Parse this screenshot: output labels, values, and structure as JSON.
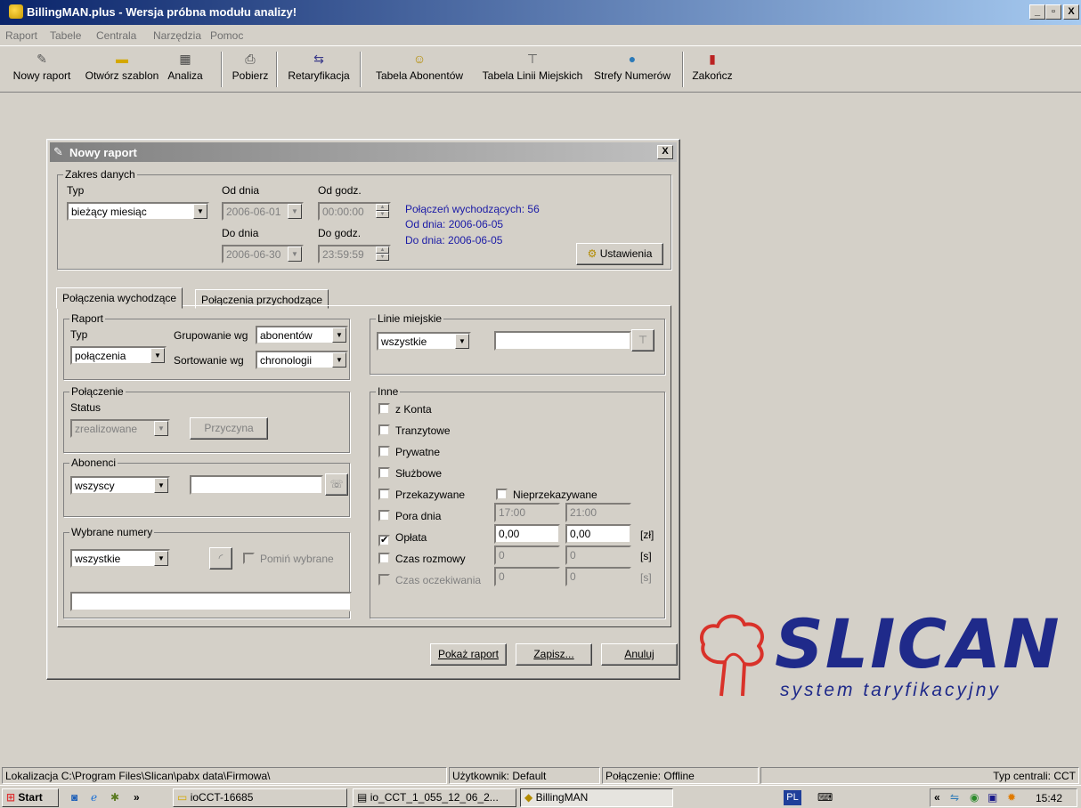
{
  "window": {
    "title": "BillingMAN.plus - Wersja próbna modułu analizy!",
    "controls": [
      "_",
      "▫",
      "X"
    ]
  },
  "menu": [
    "Raport",
    "Tabele",
    "Centrala",
    "Narzędzia",
    "Pomoc"
  ],
  "toolbar": {
    "new_report": "Nowy raport",
    "open_template": "Otwórz szablon",
    "analysis": "Analiza",
    "fetch": "Pobierz",
    "retarification": "Retaryfikacja",
    "subscribers_table": "Tabela Abonentów",
    "city_lines_table": "Tabela Linii Miejskich",
    "number_zones": "Strefy Numerów",
    "exit": "Zakończ"
  },
  "dialog": {
    "title": "Nowy raport",
    "close": "X",
    "data_range": {
      "legend": "Zakres danych",
      "type_label": "Typ",
      "type_value": "bieżący miesiąc",
      "from_day_label": "Od dnia",
      "from_day_value": "2006-06-01",
      "from_time_label": "Od godz.",
      "from_time_value": "00:00:00",
      "to_day_label": "Do dnia",
      "to_day_value": "2006-06-30",
      "to_time_label": "Do godz.",
      "to_time_value": "23:59:59",
      "info_calls": "Połączeń wychodzących: 56",
      "info_from": "Od dnia: 2006-06-05",
      "info_to": "Do dnia: 2006-06-05",
      "settings_button": "Ustawienia"
    },
    "tabs": [
      "Połączenia wychodzące",
      "Połączenia przychodzące"
    ],
    "report": {
      "legend": "Raport",
      "type_label": "Typ",
      "type_value": "połączenia",
      "group_label": "Grupowanie wg",
      "group_value": "abonentów",
      "sort_label": "Sortowanie wg",
      "sort_value": "chronologii"
    },
    "connection": {
      "legend": "Połączenie",
      "status_label": "Status",
      "status_value": "zrealizowane",
      "reason_button": "Przyczyna"
    },
    "subscribers": {
      "legend": "Abonenci",
      "value": "wszyscy"
    },
    "selected_numbers": {
      "legend": "Wybrane numery",
      "value": "wszystkie",
      "skip_selected": "Pomiń wybrane"
    },
    "city_lines": {
      "legend": "Linie miejskie",
      "value": "wszystkie"
    },
    "other": {
      "legend": "Inne",
      "from_account": "z Konta",
      "transit": "Tranzytowe",
      "private": "Prywatne",
      "business": "Służbowe",
      "forwarded": "Przekazywane",
      "not_forwarded": "Nieprzekazywane",
      "time_of_day": "Pora dnia",
      "time_from": "17:00",
      "time_to": "21:00",
      "fee": "Opłata",
      "fee_from": "0,00",
      "fee_to": "0,00",
      "fee_unit": "[zł]",
      "call_time": "Czas rozmowy",
      "call_from": "0",
      "call_to": "0",
      "call_unit": "[s]",
      "wait_time": "Czas oczekiwania",
      "wait_from": "0",
      "wait_to": "0",
      "wait_unit": "[s]"
    },
    "buttons": {
      "show_report": "Pokaż raport",
      "save": "Zapisz...",
      "cancel": "Anuluj"
    }
  },
  "logo": {
    "brand": "SLICAN",
    "subtitle": "system taryfikacyjny",
    "color": "#1f2a8a",
    "mark_color": "#d9322a"
  },
  "statusbar": {
    "location": "Lokalizacja C:\\Program Files\\Slican\\pabx data\\Firmowa\\",
    "user": "Użytkownik: Default",
    "connection": "Połączenie: Offline",
    "pbx_type": "Typ centrali: CCT"
  },
  "taskbar": {
    "start": "Start",
    "more": "»",
    "task1": "ioCCT-16685",
    "task2": "io_CCT_1_055_12_06_2...",
    "task3": "BillingMAN",
    "lang": "PL",
    "tray_more": "«",
    "clock": "15:42"
  }
}
